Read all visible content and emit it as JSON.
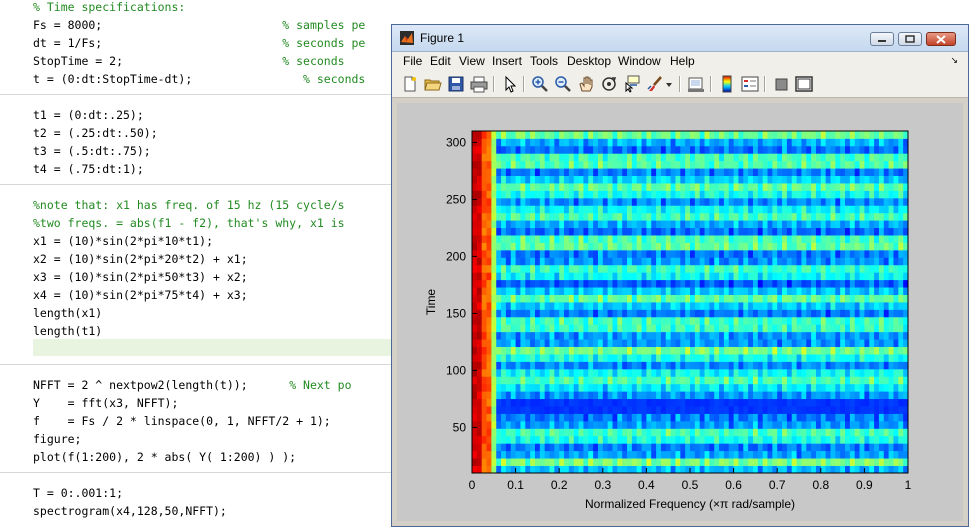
{
  "editor": {
    "lines": [
      {
        "code": "",
        "comment": "% Time specifications:"
      },
      {
        "code": "Fs = 8000;                          ",
        "comment": "% samples pe"
      },
      {
        "code": "dt = 1/Fs;                          ",
        "comment": "% seconds pe"
      },
      {
        "code": "StopTime = 2;                       ",
        "comment": "% seconds"
      },
      {
        "code": "t = (0:dt:StopTime-dt);                ",
        "comment": "% seconds"
      },
      {
        "code": "",
        "comment": ""
      },
      {
        "code": "t1 = (0:dt:.25);",
        "comment": ""
      },
      {
        "code": "t2 = (.25:dt:.50);",
        "comment": ""
      },
      {
        "code": "t3 = (.5:dt:.75);",
        "comment": ""
      },
      {
        "code": "t4 = (.75:dt:1);",
        "comment": ""
      },
      {
        "code": "",
        "comment": ""
      },
      {
        "code": "",
        "comment": "%note that: x1 has freq. of 15 hz (15 cycle/s"
      },
      {
        "code": "",
        "comment": "%two freqs. = abs(f1 - f2), that's why, x1 is"
      },
      {
        "code": "x1 = (10)*sin(2*pi*10*t1);",
        "comment": ""
      },
      {
        "code": "x2 = (10)*sin(2*pi*20*t2) + x1;",
        "comment": ""
      },
      {
        "code": "x3 = (10)*sin(2*pi*50*t3) + x2;",
        "comment": ""
      },
      {
        "code": "x4 = (10)*sin(2*pi*75*t4) + x3;",
        "comment": ""
      },
      {
        "code": "length(x1)",
        "comment": ""
      },
      {
        "code": "length(t1)",
        "comment": ""
      },
      {
        "code": "",
        "comment": ""
      },
      {
        "code": "",
        "comment": ""
      },
      {
        "code": "NFFT = 2 ^ nextpow2(length(t));      ",
        "comment": "% Next po"
      },
      {
        "code": "Y    = fft(x3, NFFT);",
        "comment": ""
      },
      {
        "code": "f    = Fs / 2 * linspace(0, 1, NFFT/2 + 1);",
        "comment": ""
      },
      {
        "code": "figure;",
        "comment": ""
      },
      {
        "code": "plot(f(1:200), 2 * abs( Y( 1:200) ) );",
        "comment": ""
      },
      {
        "code": "",
        "comment": ""
      },
      {
        "code": "T = 0:.001:1;",
        "comment": ""
      },
      {
        "code": "spectrogram(x4,128,50,NFFT);",
        "comment": ""
      }
    ]
  },
  "figure_window": {
    "title": "Figure 1",
    "menu": [
      "File",
      "Edit",
      "View",
      "Insert",
      "Tools",
      "Desktop",
      "Window",
      "Help"
    ],
    "menu_overflow_arrow": "↘",
    "toolbar_icons": [
      "new-figure-icon",
      "open-file-icon",
      "save-icon",
      "print-icon",
      "select-arrow-icon",
      "zoom-in-icon",
      "zoom-out-icon",
      "pan-hand-icon",
      "rotate-3d-icon",
      "data-cursor-icon",
      "brush-icon",
      "brush-dropdown-icon",
      "link-plot-icon",
      "colorbar-icon",
      "legend-icon",
      "hide-plot-tools-icon",
      "show-plot-tools-icon"
    ]
  },
  "chart_data": {
    "type": "heatmap",
    "title": "",
    "xlabel": "Normalized Frequency  (×π rad/sample)",
    "ylabel": "Time",
    "xlim": [
      0,
      1
    ],
    "ylim": [
      10,
      310
    ],
    "xticks": [
      "0",
      "0.1",
      "0.2",
      "0.3",
      "0.4",
      "0.5",
      "0.6",
      "0.7",
      "0.8",
      "0.9",
      "1"
    ],
    "yticks": [
      "50",
      "100",
      "150",
      "200",
      "250",
      "300"
    ],
    "colormap": "jet",
    "grid": false,
    "legend": "none",
    "description_values": {
      "low_freq_band": {
        "x_range": [
          0,
          0.05
        ],
        "intensity": "high (red/orange)"
      },
      "strong_band": {
        "time": 70,
        "x_range": [
          0.06,
          1
        ],
        "intensity": "low (dark blue)"
      }
    }
  }
}
